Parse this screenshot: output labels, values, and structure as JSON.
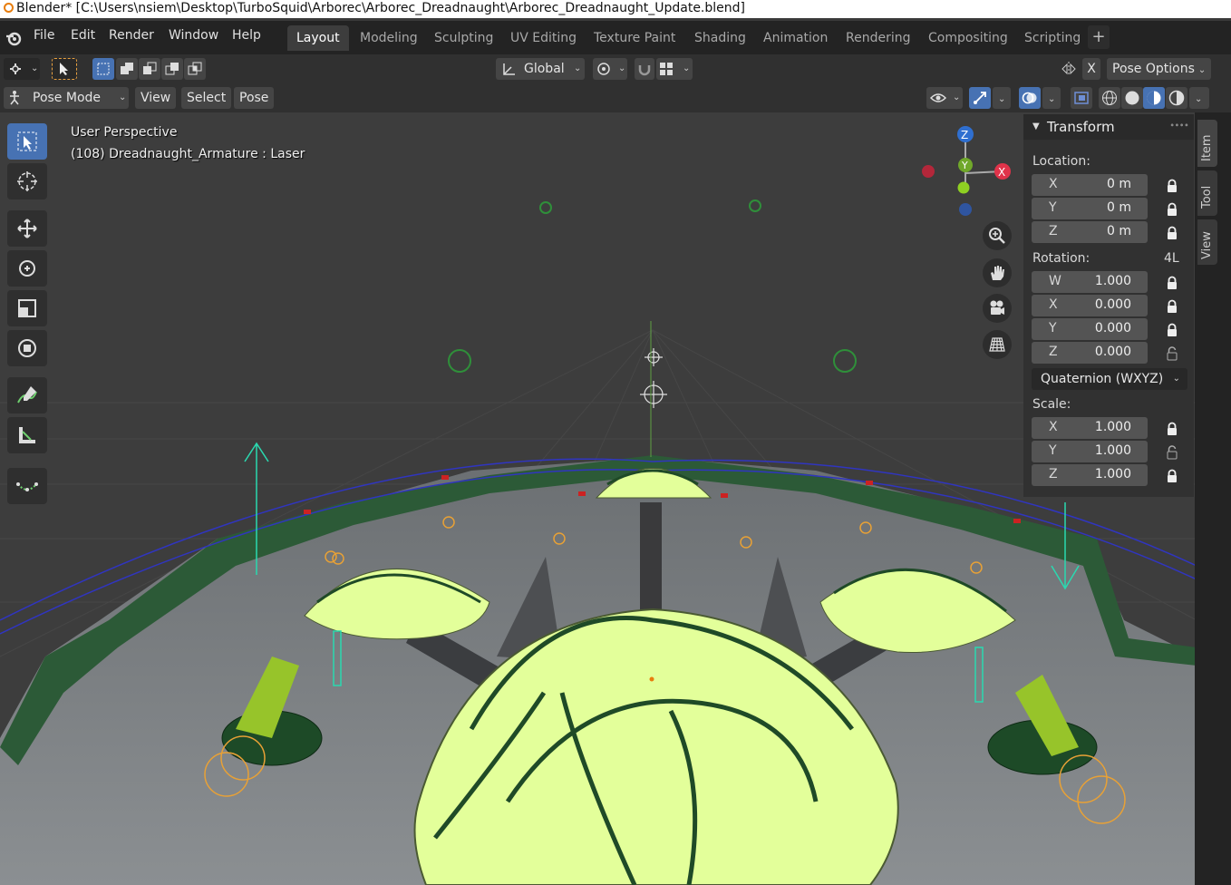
{
  "window": {
    "title": "Blender* [C:\\Users\\nsiem\\Desktop\\TurboSquid\\Arborec\\Arborec_Dreadnaught\\Arborec_Dreadnaught_Update.blend]"
  },
  "menu": [
    "File",
    "Edit",
    "Render",
    "Window",
    "Help"
  ],
  "workspaces": {
    "tabs": [
      "Layout",
      "Modeling",
      "Sculpting",
      "UV Editing",
      "Texture Paint",
      "Shading",
      "Animation",
      "Rendering",
      "Compositing",
      "Scripting"
    ],
    "active": "Layout",
    "add_label": "+"
  },
  "header": {
    "orientation": "Global",
    "pose_options": "Pose Options",
    "close_x": "X",
    "mode": "Pose Mode",
    "view_menu": "View",
    "select_menu": "Select",
    "pose_menu": "Pose"
  },
  "viewport": {
    "perspective_label": "User Perspective",
    "object_label": "(108) Dreadnaught_Armature : Laser",
    "gizmo": {
      "x": "X",
      "y": "Y",
      "z": "Z"
    },
    "colors": {
      "background": "#3d3d3d",
      "accent_green": "#e3ff9a"
    }
  },
  "toolbar": {
    "tools": [
      "select-box-icon",
      "cursor-icon",
      "move-icon",
      "rotate-icon",
      "scale-icon",
      "transform-icon",
      "annotate-icon",
      "measure-icon",
      "bone-icon"
    ]
  },
  "transform_panel": {
    "title": "Transform",
    "location_label": "Location:",
    "location": [
      {
        "axis": "X",
        "value": "0 m"
      },
      {
        "axis": "Y",
        "value": "0 m"
      },
      {
        "axis": "Z",
        "value": "0 m"
      }
    ],
    "rotation_label": "Rotation:",
    "rotation_mode_tag": "4L",
    "rotation": [
      {
        "axis": "W",
        "value": "1.000"
      },
      {
        "axis": "X",
        "value": "0.000"
      },
      {
        "axis": "Y",
        "value": "0.000"
      },
      {
        "axis": "Z",
        "value": "0.000"
      }
    ],
    "rotation_mode": "Quaternion (WXYZ)",
    "scale_label": "Scale:",
    "scale": [
      {
        "axis": "X",
        "value": "1.000"
      },
      {
        "axis": "Y",
        "value": "1.000"
      },
      {
        "axis": "Z",
        "value": "1.000"
      }
    ]
  },
  "side_tabs": [
    "Item",
    "Tool",
    "View"
  ]
}
